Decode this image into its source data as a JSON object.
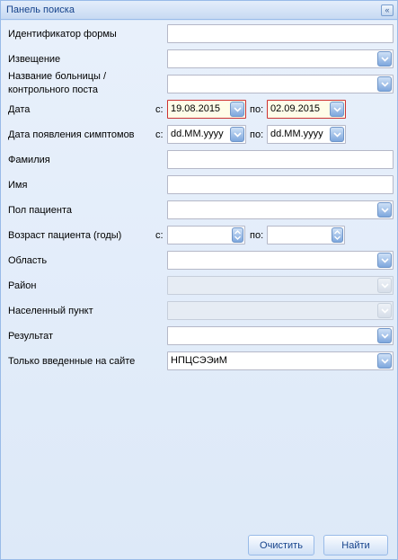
{
  "panel": {
    "title": "Панель поиска"
  },
  "fields": {
    "form_id": {
      "label": "Идентификатор формы",
      "value": ""
    },
    "notice": {
      "label": "Извещение",
      "value": ""
    },
    "hospital": {
      "label_line1": "Название больницы /",
      "label_line2": "контрольного поста",
      "value": ""
    },
    "date": {
      "label": "Дата",
      "from_prefix": "с:",
      "from_value": "19.08.2015",
      "to_prefix": "по:",
      "to_value": "02.09.2015"
    },
    "symptoms_date": {
      "label": "Дата появления симптомов",
      "from_prefix": "с:",
      "from_value": "dd.MM.yyyy",
      "to_prefix": "по:",
      "to_value": "dd.MM.yyyy"
    },
    "surname": {
      "label": "Фамилия",
      "value": ""
    },
    "name": {
      "label": "Имя",
      "value": ""
    },
    "sex": {
      "label": "Пол пациента",
      "value": ""
    },
    "age": {
      "label": "Возраст пациента (годы)",
      "from_prefix": "с:",
      "from_value": "",
      "to_prefix": "по:",
      "to_value": ""
    },
    "region": {
      "label": "Область",
      "value": ""
    },
    "district": {
      "label": "Район",
      "value": ""
    },
    "locality": {
      "label": "Населенный пункт",
      "value": ""
    },
    "result": {
      "label": "Результат",
      "value": ""
    },
    "site_only": {
      "label": "Только введенные на сайте",
      "value": "НПЦСЭЭиМ"
    }
  },
  "buttons": {
    "clear": "Очистить",
    "search": "Найти"
  },
  "colors": {
    "panel_bg": "#dde9f8",
    "header_text": "#15428b",
    "border": "#99bbe8",
    "invalid_border": "#cc3333",
    "invalid_bg": "#fffde8"
  }
}
